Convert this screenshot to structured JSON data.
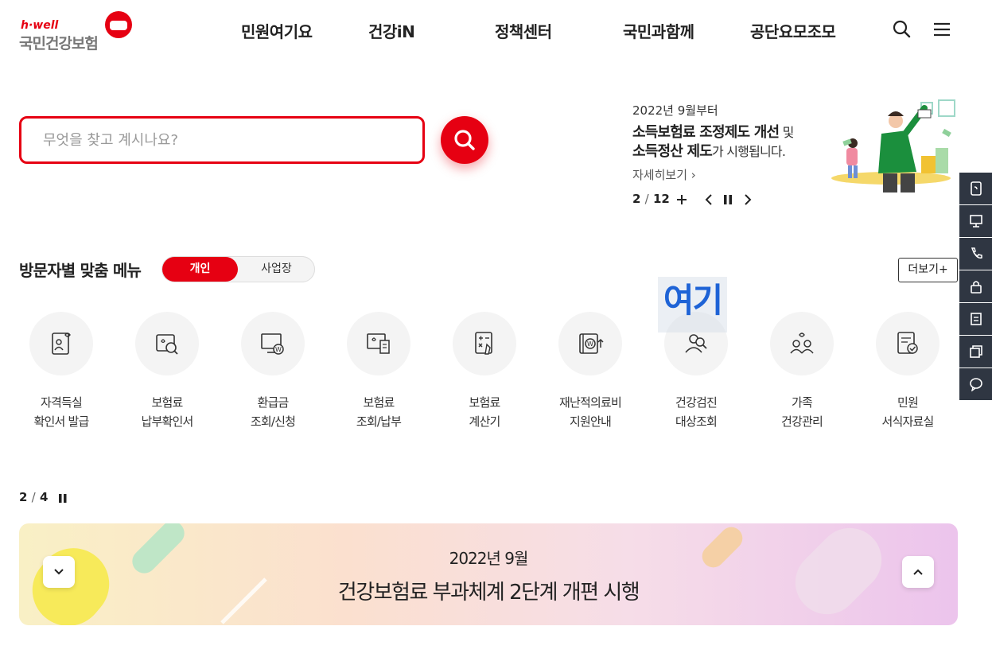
{
  "header": {
    "logo_en": "h·well",
    "logo_kr": "국민건강보험",
    "nav": [
      "민원여기요",
      "건강iN",
      "정책센터",
      "국민과함께",
      "공단요모조모"
    ]
  },
  "search": {
    "placeholder": "무엇을 찾고 계시나요?"
  },
  "promo": {
    "date": "2022년 9월부터",
    "line1_bold": "소득보험료 조정제도 개선",
    "line1_rest": " 및",
    "line2_bold": "소득정산 제도",
    "line2_rest": "가 시행됩니다.",
    "more": "자세히보기",
    "current": "2",
    "sep": "/",
    "total": "12"
  },
  "visitor_menu": {
    "title": "방문자별 맞춤 메뉴",
    "tab_on": "개인",
    "tab_off": "사업장",
    "more": "더보기+",
    "highlight": "여기",
    "items": [
      {
        "l1": "자격득실",
        "l2": "확인서 발급",
        "icon": "certificate-icon"
      },
      {
        "l1": "보험료",
        "l2": "납부확인서",
        "icon": "payment-search-icon"
      },
      {
        "l1": "환급금",
        "l2": "조회/신청",
        "icon": "refund-monitor-icon"
      },
      {
        "l1": "보험료",
        "l2": "조회/납부",
        "icon": "bill-icon"
      },
      {
        "l1": "보험료",
        "l2": "계산기",
        "icon": "calculator-icon"
      },
      {
        "l1": "재난적의료비",
        "l2": "지원안내",
        "icon": "medical-cost-icon"
      },
      {
        "l1": "건강검진",
        "l2": "대상조회",
        "icon": "checkup-icon"
      },
      {
        "l1": "가족",
        "l2": "건강관리",
        "icon": "family-icon"
      },
      {
        "l1": "민원",
        "l2": "서식자료실",
        "icon": "document-icon"
      }
    ]
  },
  "bottom": {
    "current": "2",
    "sep": "/",
    "total": "4",
    "date": "2022년 9월",
    "title": "건강보험료 부과체계 2단계 개편 시행"
  },
  "colors": {
    "brand": "#e60012",
    "quick_bg": "#2f3642",
    "highlight_text": "#1e63d6"
  }
}
